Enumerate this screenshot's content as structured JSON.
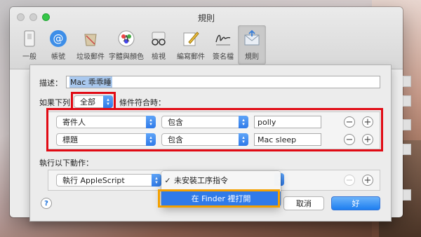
{
  "window": {
    "title": "規則"
  },
  "toolbar": [
    {
      "label": "一般",
      "icon": "general-icon"
    },
    {
      "label": "帳號",
      "icon": "at-icon"
    },
    {
      "label": "垃圾郵件",
      "icon": "junk-mail-icon"
    },
    {
      "label": "字體與顏色",
      "icon": "fonts-colors-icon"
    },
    {
      "label": "檢視",
      "icon": "glasses-icon"
    },
    {
      "label": "編寫郵件",
      "icon": "compose-icon"
    },
    {
      "label": "簽名檔",
      "icon": "signature-icon"
    },
    {
      "label": "規則",
      "icon": "rules-icon",
      "selected": true
    }
  ],
  "sheet": {
    "description_label": "描述：",
    "description_value": "Mac 乖乖睡",
    "if_label": "如果下列",
    "match_value": "全部",
    "conditions_suffix": "條件符合時：",
    "conditions": [
      {
        "field": "寄件人",
        "operator": "包含",
        "value": "polly"
      },
      {
        "field": "標題",
        "operator": "包含",
        "value": "Mac sleep"
      }
    ],
    "actions_label": "執行以下動作：",
    "action": {
      "type": "執行 AppleScript"
    },
    "cancel_label": "取消",
    "ok_label": "好",
    "help_label": "?"
  },
  "script_menu": {
    "items": [
      {
        "label": "未安裝工序指令",
        "checked": true
      },
      {
        "label": "在 Finder 裡打開",
        "highlighted": true
      }
    ]
  },
  "colors": {
    "accent": "#2f7ae9",
    "highlight_red": "#e10a14",
    "highlight_orange": "#f3a000"
  }
}
